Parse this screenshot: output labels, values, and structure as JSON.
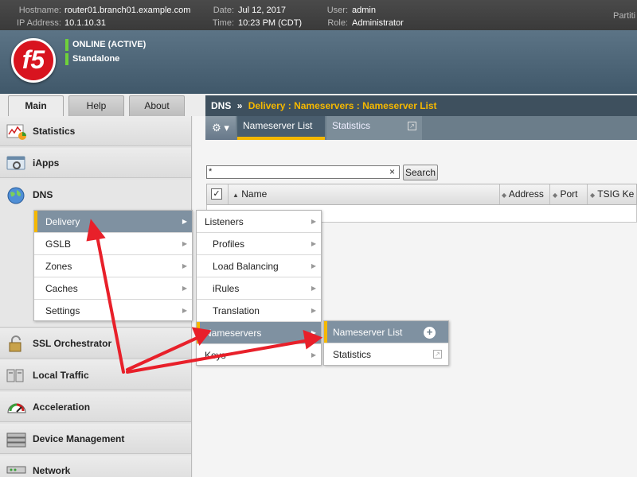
{
  "header": {
    "hostname_label": "Hostname:",
    "hostname": "router01.branch01.example.com",
    "ip_label": "IP Address:",
    "ip": "10.1.10.31",
    "date_label": "Date:",
    "date": "Jul 12, 2017",
    "time_label": "Time:",
    "time": "10:23 PM (CDT)",
    "user_label": "User:",
    "user": "admin",
    "role_label": "Role:",
    "role": "Administrator",
    "partition_label": "Partiti"
  },
  "banner": {
    "logo_text": "f5",
    "status": "ONLINE (ACTIVE)",
    "mode": "Standalone",
    "status_color": "#6fd13a"
  },
  "main_tabs": [
    {
      "label": "Main"
    },
    {
      "label": "Help"
    },
    {
      "label": "About"
    }
  ],
  "sidebar": {
    "items": [
      {
        "label": "Statistics",
        "icon": "statistics-icon"
      },
      {
        "label": "iApps",
        "icon": "iapps-icon"
      },
      {
        "label": "DNS",
        "icon": "globe-icon"
      },
      {
        "label": "SSL Orchestrator",
        "icon": "lock-icon"
      },
      {
        "label": "Local Traffic",
        "icon": "local-traffic-icon"
      },
      {
        "label": "Acceleration",
        "icon": "speedometer-icon"
      },
      {
        "label": "Device Management",
        "icon": "device-icon"
      },
      {
        "label": "Network",
        "icon": "network-icon"
      }
    ]
  },
  "breadcrumb": {
    "root": "DNS",
    "separator": "»",
    "path": "Delivery : Nameservers : Nameserver List"
  },
  "subtabs": {
    "gear": "⚙ ▾",
    "list": "Nameserver List",
    "stats": "Statistics"
  },
  "search": {
    "value": "*",
    "clear": "×",
    "button": "Search"
  },
  "table": {
    "columns": [
      "Name",
      "Address",
      "Port",
      "TSIG Ke"
    ]
  },
  "menus": {
    "dns": [
      "Delivery",
      "GSLB",
      "Zones",
      "Caches",
      "Settings"
    ],
    "delivery": [
      "Listeners",
      "Profiles",
      "Load Balancing",
      "iRules",
      "Translation",
      "Nameservers",
      "Keys"
    ],
    "nameservers": [
      "Nameserver List",
      "Statistics"
    ]
  },
  "colors": {
    "accent": "#f5b800",
    "arrow": "#e8202a",
    "menu_active": "#7f91a1"
  }
}
